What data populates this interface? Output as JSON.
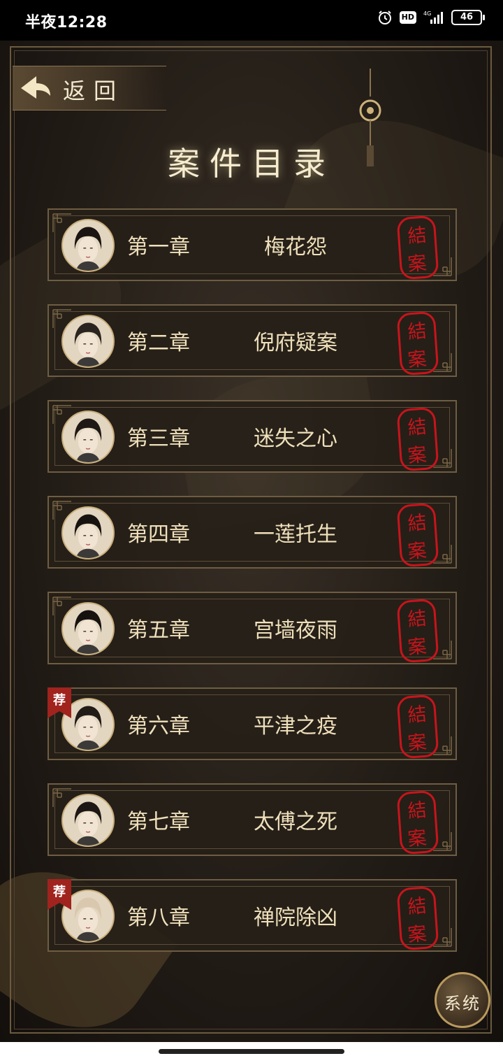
{
  "status_bar": {
    "time": "半夜12:28",
    "hd": "HD",
    "network": "4G",
    "battery": "46"
  },
  "header": {
    "back_label": "返回",
    "title": "案件目录"
  },
  "chapters": [
    {
      "number": "第一章",
      "title": "梅花怨",
      "seal": "結案",
      "recommended": false
    },
    {
      "number": "第二章",
      "title": "倪府疑案",
      "seal": "結案",
      "recommended": false
    },
    {
      "number": "第三章",
      "title": "迷失之心",
      "seal": "結案",
      "recommended": false
    },
    {
      "number": "第四章",
      "title": "一莲托生",
      "seal": "結案",
      "recommended": false
    },
    {
      "number": "第五章",
      "title": "宫墙夜雨",
      "seal": "結案",
      "recommended": false
    },
    {
      "number": "第六章",
      "title": "平津之疫",
      "seal": "結案",
      "recommended": true,
      "tag": "荐"
    },
    {
      "number": "第七章",
      "title": "太傅之死",
      "seal": "結案",
      "recommended": false
    },
    {
      "number": "第八章",
      "title": "禅院除凶",
      "seal": "結案",
      "recommended": true,
      "tag": "荐"
    }
  ],
  "footer": {
    "system_label": "系统"
  },
  "colors": {
    "gold_text": "#efe0bb",
    "seal_red": "#c8141c",
    "frame": "#6e5d42",
    "background": "#231d17"
  }
}
